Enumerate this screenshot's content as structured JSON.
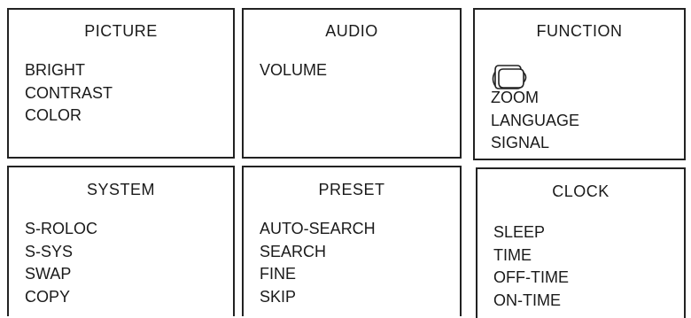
{
  "panels": {
    "picture": {
      "title": "PICTURE",
      "items": [
        "BRIGHT",
        "CONTRAST",
        "COLOR"
      ]
    },
    "audio": {
      "title": "AUDIO",
      "items": [
        "VOLUME"
      ]
    },
    "function": {
      "title": "FUNCTION",
      "icon": "tv-screen-icon",
      "items": [
        "ZOOM",
        "LANGUAGE",
        "SIGNAL"
      ]
    },
    "system": {
      "title": "SYSTEM",
      "items": [
        "S-ROLOC",
        "S-SYS",
        "SWAP",
        "COPY"
      ]
    },
    "preset": {
      "title": "PRESET",
      "items": [
        "AUTO-SEARCH",
        "SEARCH",
        "FINE",
        "SKIP"
      ]
    },
    "clock": {
      "title": "CLOCK",
      "items": [
        "SLEEP",
        "TIME",
        "OFF-TIME",
        "ON-TIME"
      ]
    }
  }
}
